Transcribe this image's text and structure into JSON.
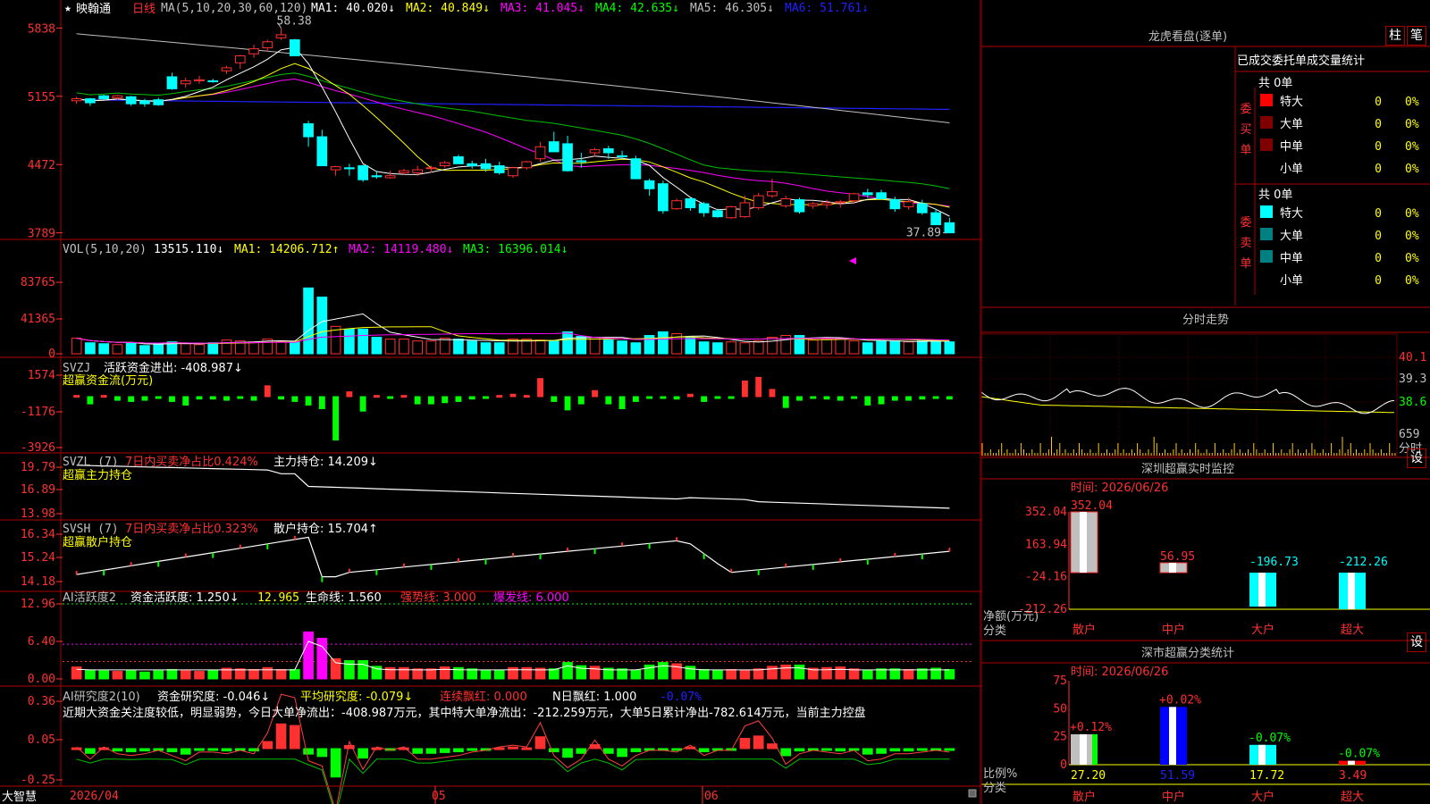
{
  "app": {
    "brand": "大智慧",
    "date_label": "2026/04",
    "month_may": "05",
    "month_jun": "06"
  },
  "price": {
    "star": "★",
    "name": "映翰通",
    "period": "日线",
    "ma_label": "MA(5,10,20,30,60,120)",
    "ma1": "MA1: 40.020↓",
    "ma2": "MA2: 40.849↓",
    "ma3": "MA3: 41.045↓",
    "ma4": "MA4: 42.635↓",
    "ma5": "MA5: 46.305↓",
    "ma6": "MA6: 51.761↓",
    "ticks": [
      "5838",
      "5155",
      "4472",
      "3789"
    ],
    "high_label": "58.38",
    "low_label": "37.89"
  },
  "vol": {
    "label": "VOL(5,10,20)",
    "value": "13515.110↓",
    "ma1": "MA1: 14206.712↑",
    "ma2": "MA2: 14119.480↓",
    "ma3": "MA3: 16396.014↓",
    "ticks": [
      "83765",
      "41365",
      "0"
    ]
  },
  "svzj": {
    "label": "SVZJ",
    "title": "活跃资金进出: -408.987↓",
    "subtitle": "超赢资金流(万元)",
    "ticks": [
      "1574",
      "-1176",
      "-3926"
    ]
  },
  "svzl": {
    "label": "SVZL (7)",
    "ratio": "7日内买卖净占比0.424%",
    "hold": "主力持仓: 14.209↓",
    "subtitle": "超赢主力持仓",
    "ticks": [
      "19.79",
      "16.89",
      "13.98"
    ]
  },
  "svsh": {
    "label": "SVSH (7)",
    "ratio": "7日内买卖净占比0.323%",
    "hold": "散户持仓: 15.704↑",
    "subtitle": "超赢散户持仓",
    "ticks": [
      "16.34",
      "15.24",
      "14.18"
    ]
  },
  "ai_active": {
    "label": "AI活跃度2",
    "active": "资金活跃度: 1.250↓",
    "val2": "12.965",
    "life": "生命线: 1.560",
    "strong": "强势线: 3.000",
    "burst": "爆发线: 6.000",
    "ticks": [
      "12.96",
      "6.40",
      "0.00"
    ]
  },
  "ai_research": {
    "label": "AI研究度2(10)",
    "research": "资金研究度: -0.046↓",
    "avg": "平均研究度: -0.079↓",
    "red_cont": "连续飘红: 0.000",
    "n_red": "N日飘红: 1.000",
    "last": "-0.07%",
    "ticks": [
      "0.36",
      "0.05",
      "-0.25"
    ],
    "comment": "近期大资金关注度较低，明显弱势，今日大单净流出：-408.987万元，其中特大单净流出：-212.259万元，大单5日累计净出-782.614万元，当前主力控盘"
  },
  "dragon": {
    "title": "龙虎看盘(逐单)",
    "btn_zhu": "柱",
    "btn_bi": "笔",
    "header": "已成交委托单成交量统计",
    "buy_total": "共 0单",
    "buy_side": "委买单",
    "sell_total": "共 0单",
    "sell_side": "委卖单",
    "buy_rows": [
      {
        "name": "特大",
        "count": "0",
        "pct": "0%",
        "color": "#ff0000"
      },
      {
        "name": "大单",
        "count": "0",
        "pct": "0%",
        "color": "#800000"
      },
      {
        "name": "中单",
        "count": "0",
        "pct": "0%",
        "color": "#800000"
      },
      {
        "name": "小单",
        "count": "0",
        "pct": "0%",
        "color": "#000000"
      }
    ],
    "sell_rows": [
      {
        "name": "特大",
        "count": "0",
        "pct": "0%",
        "color": "#00ffff"
      },
      {
        "name": "大单",
        "count": "0",
        "pct": "0%",
        "color": "#008080"
      },
      {
        "name": "中单",
        "count": "0",
        "pct": "0%",
        "color": "#008080"
      },
      {
        "name": "小单",
        "count": "0",
        "pct": "0%",
        "color": "#000000"
      }
    ]
  },
  "intraday": {
    "title": "分时走势",
    "ticks": [
      "40.1",
      "39.3",
      "38.6"
    ],
    "vol_tick": "659",
    "label": "分时"
  },
  "monitor": {
    "title": "深圳超赢实时监控",
    "btn": "设",
    "time": "时间: 2026/06/26",
    "ticks": [
      "352.04",
      "163.94",
      "-24.16",
      "-212.26"
    ],
    "ylabel": "净额(万元)",
    "xlabel": "分类",
    "cats": [
      "散户",
      "中户",
      "大户",
      "超大"
    ],
    "values": [
      352.04,
      56.95,
      -196.73,
      -212.26
    ],
    "value_labels": [
      "352.04",
      "56.95",
      "-196.73",
      "-212.26"
    ]
  },
  "classify": {
    "title": "深市超赢分类统计",
    "btn": "设",
    "time": "时间: 2026/06/26",
    "ticks": [
      "75",
      "50",
      "25",
      "0"
    ],
    "ylabel": "比例%",
    "xlabel": "分类",
    "cats": [
      "散户",
      "中户",
      "大户",
      "超大"
    ],
    "values": [
      27.2,
      51.59,
      17.72,
      3.49
    ],
    "value_labels": [
      "27.20",
      "51.59",
      "17.72",
      "3.49"
    ],
    "change_labels": [
      "+0.12%",
      "+0.02%",
      "-0.07%",
      "-0.07%"
    ]
  },
  "chart_data": {
    "type": "candlestick",
    "candles": [
      [
        51.1,
        51.5,
        50.8,
        51.3
      ],
      [
        51.3,
        51.4,
        50.6,
        50.9
      ],
      [
        51.6,
        51.7,
        51.2,
        51.3
      ],
      [
        51.4,
        51.7,
        51.2,
        51.6
      ],
      [
        51.5,
        51.6,
        50.6,
        50.8
      ],
      [
        51.1,
        51.3,
        50.5,
        50.8
      ],
      [
        51.2,
        51.4,
        50.6,
        50.7
      ],
      [
        53.5,
        53.9,
        52.2,
        52.3
      ],
      [
        52.8,
        53.4,
        52.4,
        53.1
      ],
      [
        53.1,
        53.6,
        52.8,
        53.2
      ],
      [
        53.1,
        53.3,
        52.9,
        53.0
      ],
      [
        54.1,
        54.6,
        53.8,
        54.4
      ],
      [
        54.9,
        55.7,
        54.3,
        55.6
      ],
      [
        55.8,
        56.7,
        55.4,
        56.3
      ],
      [
        56.4,
        57.2,
        56.0,
        57.0
      ],
      [
        57.4,
        58.38,
        57.2,
        57.7
      ],
      [
        57.2,
        57.3,
        55.6,
        55.6
      ],
      [
        48.8,
        49.1,
        46.5,
        47.5
      ],
      [
        47.5,
        48.2,
        44.6,
        44.6
      ],
      [
        44.2,
        44.6,
        43.6,
        44.5
      ],
      [
        44.4,
        44.8,
        43.6,
        44.3
      ],
      [
        44.6,
        44.7,
        43.0,
        43.2
      ],
      [
        43.6,
        44.1,
        43.3,
        43.5
      ],
      [
        43.4,
        44.1,
        43.3,
        43.6
      ],
      [
        43.9,
        44.3,
        43.7,
        44.1
      ],
      [
        43.9,
        44.6,
        43.6,
        44.2
      ],
      [
        44.4,
        44.6,
        43.9,
        44.4
      ],
      [
        44.6,
        45.1,
        44.4,
        44.9
      ],
      [
        45.5,
        45.7,
        44.8,
        44.8
      ],
      [
        44.8,
        45.1,
        44.3,
        44.6
      ],
      [
        44.8,
        45.3,
        44.0,
        44.3
      ],
      [
        44.6,
        45.0,
        43.7,
        43.9
      ],
      [
        43.6,
        44.5,
        43.4,
        44.4
      ],
      [
        44.4,
        45.1,
        44.2,
        45.0
      ],
      [
        45.3,
        47.0,
        45.0,
        46.5
      ],
      [
        47.0,
        48.0,
        46.3,
        46.0
      ],
      [
        46.8,
        47.6,
        44.0,
        44.1
      ],
      [
        45.1,
        45.9,
        44.4,
        45.0
      ],
      [
        45.9,
        46.4,
        45.5,
        46.2
      ],
      [
        46.3,
        46.6,
        45.3,
        45.9
      ],
      [
        45.6,
        46.1,
        45.3,
        45.5
      ],
      [
        45.3,
        45.6,
        43.3,
        43.3
      ],
      [
        43.1,
        43.3,
        41.6,
        42.3
      ],
      [
        42.8,
        43.1,
        39.8,
        40.1
      ],
      [
        40.3,
        41.3,
        40.2,
        41.1
      ],
      [
        41.3,
        41.4,
        40.1,
        40.4
      ],
      [
        40.8,
        41.0,
        39.5,
        39.9
      ],
      [
        40.1,
        40.3,
        39.4,
        39.5
      ],
      [
        39.4,
        40.6,
        39.3,
        40.5
      ],
      [
        39.5,
        41.6,
        39.4,
        40.9
      ],
      [
        40.4,
        41.9,
        40.2,
        41.6
      ],
      [
        41.6,
        43.3,
        41.4,
        42.0
      ],
      [
        40.6,
        41.6,
        40.4,
        41.3
      ],
      [
        41.2,
        41.4,
        39.8,
        40.0
      ],
      [
        40.6,
        41.0,
        40.3,
        40.8
      ],
      [
        40.7,
        41.2,
        40.3,
        40.9
      ],
      [
        40.9,
        41.2,
        40.4,
        41.0
      ],
      [
        41.1,
        41.9,
        40.8,
        41.8
      ],
      [
        41.9,
        42.3,
        41.4,
        41.7
      ],
      [
        41.9,
        42.2,
        41.3,
        41.3
      ],
      [
        41.2,
        41.5,
        40.0,
        40.3
      ],
      [
        40.5,
        41.4,
        40.2,
        41.0
      ],
      [
        40.8,
        41.2,
        39.7,
        39.9
      ],
      [
        39.9,
        40.3,
        38.7,
        38.7
      ],
      [
        38.9,
        39.4,
        37.89,
        37.89
      ]
    ],
    "volume": [
      1.7,
      1.2,
      1.1,
      1.0,
      1.2,
      0.9,
      1.1,
      1.3,
      1.1,
      1.0,
      1.2,
      1.5,
      1.4,
      1.3,
      1.6,
      1.3,
      1.3,
      7.2,
      6.2,
      3.0,
      2.7,
      2.7,
      1.8,
      1.6,
      1.6,
      1.4,
      1.4,
      1.7,
      1.6,
      1.4,
      1.2,
      1.2,
      1.6,
      1.6,
      1.5,
      1.4,
      2.4,
      1.9,
      1.8,
      1.5,
      1.4,
      1.2,
      2.0,
      2.4,
      2.2,
      1.8,
      1.3,
      1.2,
      1.3,
      1.2,
      1.4,
      1.8,
      2.0,
      2.0,
      1.5,
      1.6,
      1.7,
      1.4,
      1.2,
      1.4,
      1.4,
      1.3,
      1.4,
      1.5,
      1.3
    ],
    "svzj": [
      0.1,
      -0.6,
      0.1,
      -0.3,
      -0.4,
      -0.3,
      -0.1,
      -0.4,
      -0.7,
      -0.2,
      -0.2,
      -0.3,
      -0.1,
      -0.3,
      0.9,
      -0.2,
      -0.4,
      -0.7,
      -1.0,
      -3.6,
      0.4,
      -1.2,
      0.1,
      -0.1,
      0.1,
      -0.6,
      -0.6,
      -0.5,
      -0.4,
      -0.2,
      -0.1,
      0.1,
      0.2,
      0.1,
      1.5,
      -0.4,
      -1.1,
      -0.6,
      0.5,
      -0.6,
      -1.0,
      -0.4,
      -0.1,
      -0.1,
      -0.2,
      0.2,
      -0.4,
      -0.1,
      -0.1,
      1.3,
      1.6,
      0.6,
      -0.9,
      -0.3,
      -0.1,
      -0.2,
      -0.3,
      -0.1,
      -0.7,
      -0.6,
      -0.3,
      -0.3,
      -0.2,
      -0.1,
      -0.2
    ],
    "life_line": 1.56,
    "strong_line": 3.0,
    "burst_line": 6.0
  }
}
